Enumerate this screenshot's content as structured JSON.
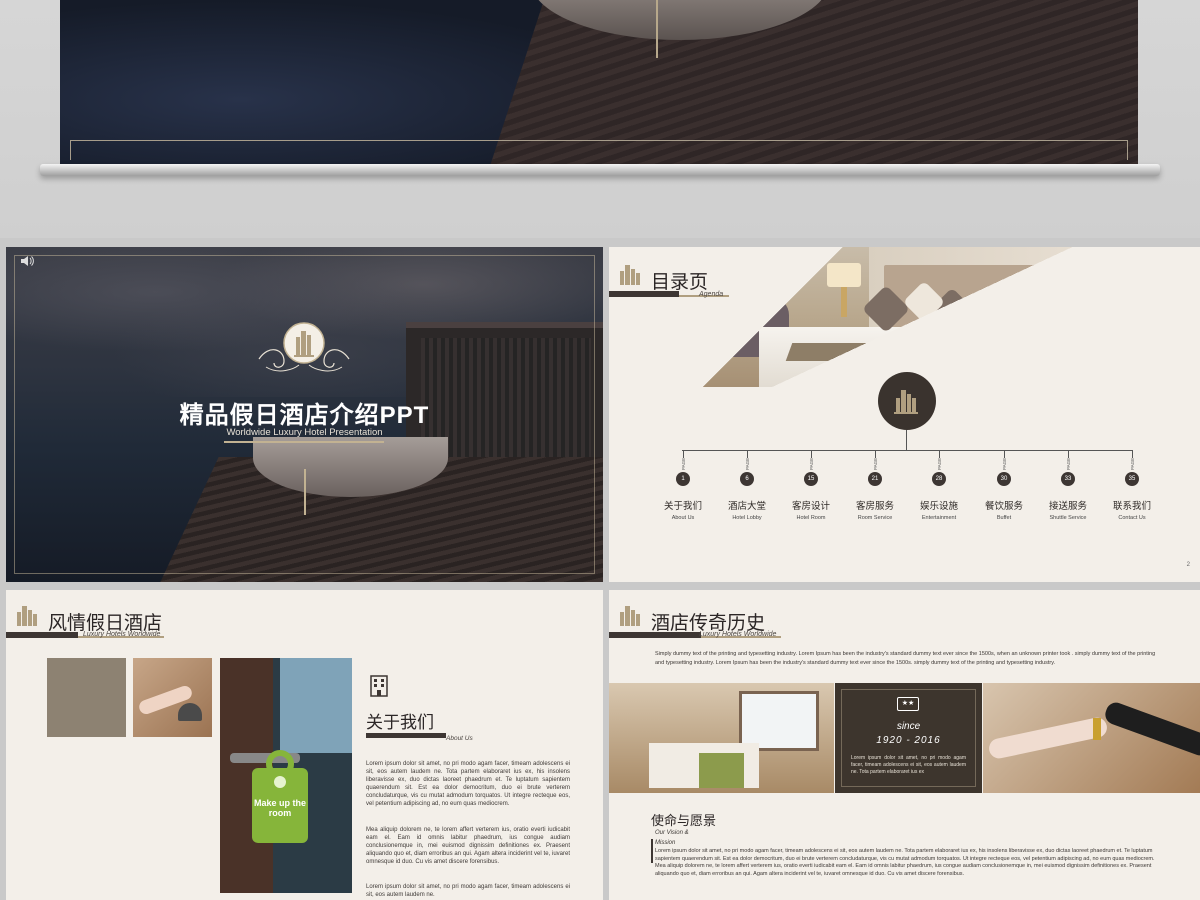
{
  "slide1": {
    "title": "精品假日酒店介绍PPT",
    "subtitle": "Worldwide Luxury Hotel Presentation"
  },
  "slide2": {
    "title": "目录页",
    "subtitle": "Agenda",
    "page_label": "PAGE",
    "page_number": "2",
    "items": [
      {
        "num": "1",
        "zh": "关于我们",
        "en": "About Us"
      },
      {
        "num": "6",
        "zh": "酒店大堂",
        "en": "Hotel Lobby"
      },
      {
        "num": "15",
        "zh": "客房设计",
        "en": "Hotel Room"
      },
      {
        "num": "21",
        "zh": "客房服务",
        "en": "Room Service"
      },
      {
        "num": "28",
        "zh": "娱乐设施",
        "en": "Entertainment"
      },
      {
        "num": "30",
        "zh": "餐饮服务",
        "en": "Buffet"
      },
      {
        "num": "33",
        "zh": "接送服务",
        "en": "Shuttle Service"
      },
      {
        "num": "35",
        "zh": "联系我们",
        "en": "Contact Us"
      }
    ]
  },
  "slide3": {
    "title": "风情假日酒店",
    "subtitle": "Luxury Hotels Worldwide",
    "hanger_text": "Make up the room",
    "about_title": "关于我们",
    "about_subtitle": "About Us",
    "para1": "Lorem ipsum dolor sit amet, no pri modo agam facer, timeam adolescens ei sit, eos autem laudem ne. Tota partem elaboraret ius ex, his insolens liberavisse ex, duo dictas laoreet phaedrum et. Te luptatum sapientem quaerendum sit. Est ea dolor democritum, duo ei brute verterem concludaturque, vis cu mutat admodum torquatos. Ut integre recteque eos, vel petentium adipiscing ad, no eum quas mediocrem.",
    "para2": "Mea aliquip dolorem ne, te lorem affert verterem ius, oratio everti iudicabit eam el. Eam id omnis labitur phaedrum, ius congue audiam conclusionemque in, mei euismod dignissim definitiones ex. Praesent aliquando quo et, diam erroribus an qui. Agam altera inciderint vel te, iuvaret omnesque id duo. Cu vis amet discere forensibus.",
    "para3": "Lorem ipsum dolor sit amet, no pri modo agam facer, timeam adolescens ei sit, eos autem laudem ne."
  },
  "slide4": {
    "title": "酒店传奇历史",
    "subtitle": "Luxury Hotels Worldwide",
    "intro": "Simply dummy text of the printing and typesetting industry. Lorem Ipsum has been the industry's standard dummy text ever since the 1500s, when an unknown printer took . simply dummy text of the printing and typesetting industry. Lorem Ipsum has been the industry's standard dummy text ever since the 1500s. simply dummy text of the printing and typesetting industry.",
    "since": "since",
    "years": "1920 - 2016",
    "panel_text": "Lorem ipsum dolor sit amet, no pri modo agam facer, timeam adolescens ei sit, eos autem laudem ne. Tota partem elaboraret ius ex",
    "mission_title": "使命与愿景",
    "mission_subtitle": "Our Vision & Mission",
    "mission_text": "Lorem ipsum dolor sit amet, no pri modo agam facer, timeam adolescens ei sit, eos autem laudem ne. Tota partem elaboraret ius ex, his insolens liberavisse ex, duo dictas laoreet phaedrum et. Te luptatum sapientem quaerendum sit. Est ea dolor democritum, duo ei brute verterem concludaturque, vis cu mutat admodum torquatos. Ut integre recteque eos, vel petentium adipiscing ad, no eum quas mediocrem. Mea aliquip dolorem ne, te lorem affert verterem ius, oratio everti iudicabit eam el. Eam id omnis labitur phaedrum, ius congue audiam conclusionemque in, mei euismod dignissim definitiones ex. Praesent aliquando quo et, diam erroribus an qui. Agam altera inciderint vel te, iuvaret omnesque id duo. Cu vis amet discere forensibus."
  },
  "colors": {
    "accent_dark": "#3d3633",
    "accent_gold": "#b09f80",
    "slide_bg": "#f3efe9",
    "hanger_green": "#86b53a"
  }
}
